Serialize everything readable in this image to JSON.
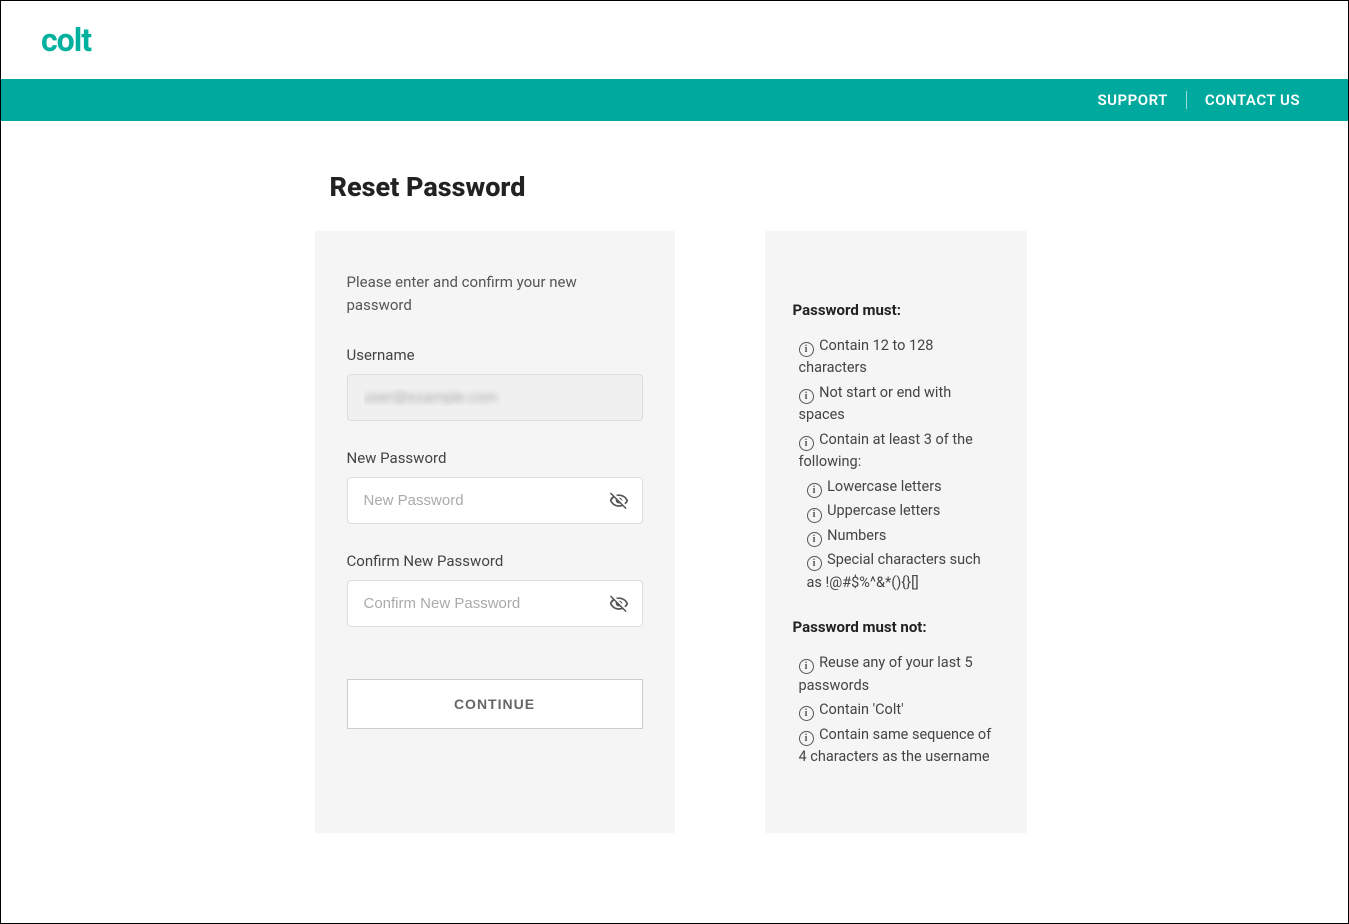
{
  "brand": {
    "logo_text": "colt"
  },
  "nav": {
    "support": "SUPPORT",
    "contact_us": "CONTACT US"
  },
  "page": {
    "title": "Reset Password"
  },
  "form": {
    "instruction": "Please enter and confirm your new password",
    "username_label": "Username",
    "username_value": "user@example.com",
    "new_password_label": "New Password",
    "new_password_placeholder": "New Password",
    "confirm_password_label": "Confirm New Password",
    "confirm_password_placeholder": "Confirm New Password",
    "continue_label": "CONTINUE"
  },
  "rules": {
    "must_heading": "Password must:",
    "must_items": [
      "Contain 12 to 128 characters",
      "Not start or end with spaces",
      "Contain at least 3 of the following:"
    ],
    "must_sub_items": [
      "Lowercase letters",
      "Uppercase letters",
      "Numbers",
      "Special characters such as !@#$%^&*(){}[]"
    ],
    "must_not_heading": "Password must not:",
    "must_not_items": [
      "Reuse any of your last 5 passwords",
      "Contain 'Colt'",
      "Contain same sequence of 4 characters as the username"
    ]
  }
}
